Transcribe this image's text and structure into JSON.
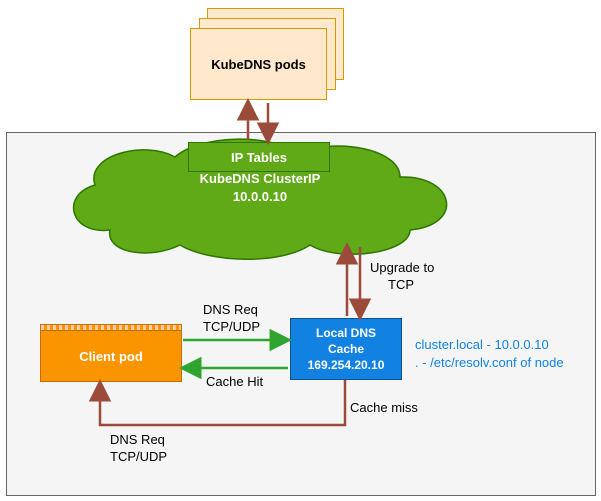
{
  "pods": {
    "label": "KubeDNS pods"
  },
  "iptables": {
    "label": "IP Tables"
  },
  "cluster": {
    "title": "KubeDNS ClusterIP",
    "ip": "10.0.0.10"
  },
  "clientpod": {
    "label": "Client pod"
  },
  "localdns": {
    "title": "Local DNS",
    "title2": "Cache",
    "ip": "169.254.20.10"
  },
  "note": {
    "line1": "cluster.local - 10.0.0.10",
    "line2": ". - /etc/resolv.conf of node"
  },
  "labels": {
    "upgradeTCP1": "Upgrade to",
    "upgradeTCP2": "TCP",
    "dnsReqA1": "DNS Req",
    "dnsReqA2": "TCP/UDP",
    "cacheHit": "Cache Hit",
    "cacheMiss": "Cache miss",
    "dnsReqB1": "DNS Req",
    "dnsReqB2": "TCP/UDP"
  }
}
